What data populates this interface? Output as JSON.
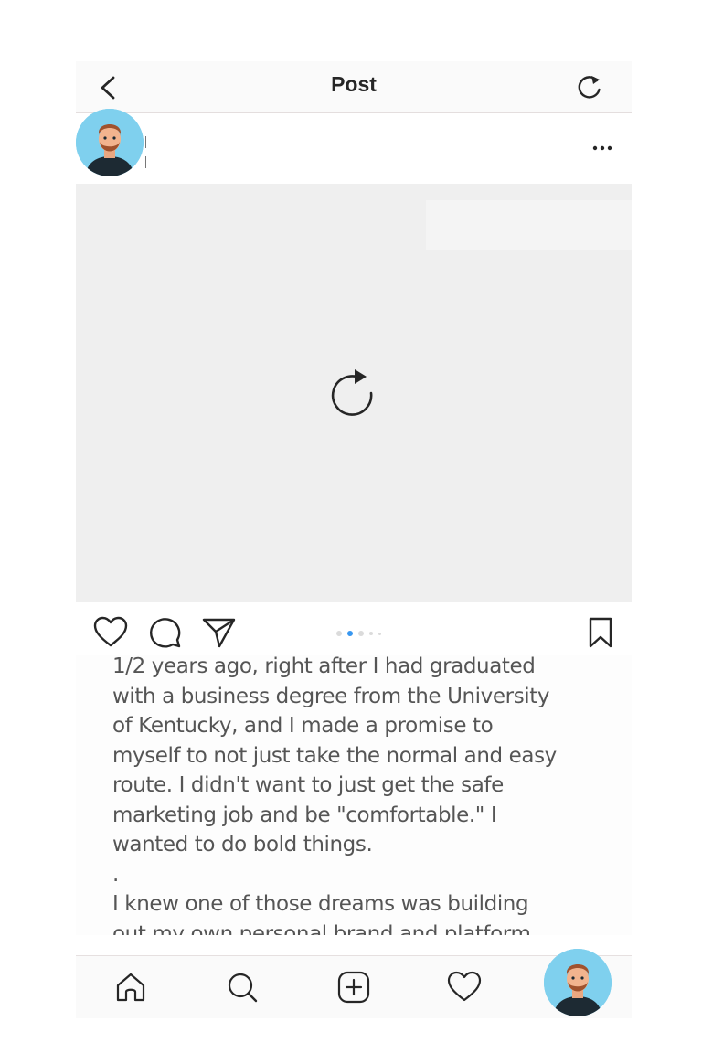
{
  "topbar": {
    "title": "Post",
    "back_icon": "chevron-left-icon",
    "refresh_icon": "refresh-icon"
  },
  "header": {
    "avatar_icon": "user-avatar-icon",
    "more_icon": "more-horizontal-icon"
  },
  "media": {
    "reload_icon": "reload-icon",
    "background": "#efefef"
  },
  "actions": {
    "like_icon": "heart-icon",
    "comment_icon": "comment-icon",
    "share_icon": "send-icon",
    "save_icon": "bookmark-icon",
    "carousel_dots": 5,
    "carousel_active_index": 1,
    "accent": "#3897f0"
  },
  "caption": {
    "text": "1/2 years ago, right after I had graduated\nwith a business degree from the University\nof Kentucky, and I made a promise to\nmyself to not just take the normal and easy\nroute. I didn't want to just get the safe\nmarketing job and be \"comfortable.\" I\nwanted to do bold things.\n.\nI knew one of those dreams was building\nout my own personal brand and platform"
  },
  "bottom_nav": {
    "home_icon": "home-icon",
    "search_icon": "search-icon",
    "add_icon": "add-post-icon",
    "activity_icon": "heart-icon",
    "profile_icon": "user-avatar-icon"
  }
}
